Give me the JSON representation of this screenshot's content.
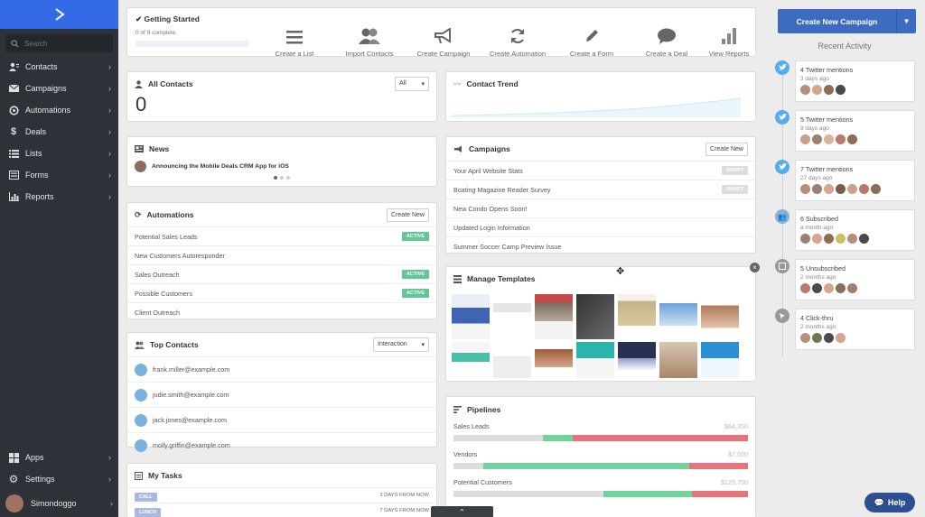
{
  "sidebar": {
    "search_placeholder": "Search",
    "items": [
      {
        "label": "Contacts",
        "icon": "contacts-icon"
      },
      {
        "label": "Campaigns",
        "icon": "mail-icon"
      },
      {
        "label": "Automations",
        "icon": "automation-icon"
      },
      {
        "label": "Deals",
        "icon": "dollar-icon"
      },
      {
        "label": "Lists",
        "icon": "list-icon"
      },
      {
        "label": "Forms",
        "icon": "form-icon"
      },
      {
        "label": "Reports",
        "icon": "chart-icon"
      }
    ],
    "bottom": [
      {
        "label": "Apps",
        "icon": "apps-icon"
      },
      {
        "label": "Settings",
        "icon": "gear-icon"
      }
    ],
    "user": "Simondoggo"
  },
  "getting_started": {
    "title": "Getting Started",
    "progress_text": "0 of 9 complete",
    "progress": 0
  },
  "tools": [
    {
      "label": "Create a List",
      "icon": "list-icon"
    },
    {
      "label": "Import Contacts",
      "icon": "users-icon"
    },
    {
      "label": "Create Campaign",
      "icon": "megaphone-icon"
    },
    {
      "label": "Create Automation",
      "icon": "refresh-icon"
    },
    {
      "label": "Create a Form",
      "icon": "pencil-icon"
    },
    {
      "label": "Create a Deal",
      "icon": "chat-icon"
    },
    {
      "label": "View Reports",
      "icon": "bar-chart-icon"
    }
  ],
  "all_contacts": {
    "title": "All Contacts",
    "count": "0",
    "filter": "All"
  },
  "contact_trend": {
    "title": "Contact Trend"
  },
  "news": {
    "title": "News",
    "headline": "Announcing the Mobile Deals CRM App for iOS"
  },
  "campaigns": {
    "title": "Campaigns",
    "create": "Create New",
    "rows": [
      {
        "name": "Your April Website Stats",
        "status": "DRAFT"
      },
      {
        "name": "Boating Magazine Reader Survey",
        "status": "DRAFT"
      },
      {
        "name": "New Condo Opens Soon!",
        "status": ""
      },
      {
        "name": "Updated Login Information",
        "status": ""
      },
      {
        "name": "Summer Soccer Camp Preview Issue",
        "status": ""
      }
    ]
  },
  "automations": {
    "title": "Automations",
    "create": "Create New",
    "rows": [
      {
        "name": "Potential Sales Leads",
        "status": "ACTIVE"
      },
      {
        "name": "New Customers Autoresponder",
        "status": ""
      },
      {
        "name": "Sales Outreach",
        "status": "ACTIVE"
      },
      {
        "name": "Possible Customers",
        "status": "ACTIVE"
      },
      {
        "name": "Client Outreach",
        "status": ""
      }
    ]
  },
  "templates": {
    "title": "Manage Templates"
  },
  "top_contacts": {
    "title": "Top Contacts",
    "sort": "Interaction",
    "rows": [
      "frank.miller@example.com",
      "judie.smith@example.com",
      "jack.jones@example.com",
      "molly.griffin@example.com"
    ]
  },
  "pipelines": {
    "title": "Pipelines",
    "rows": [
      {
        "name": "Sales Leads",
        "value": "$64,350"
      },
      {
        "name": "Vendors",
        "value": "$7,500"
      },
      {
        "name": "Potential Customers",
        "value": "$125,750"
      }
    ]
  },
  "tasks": {
    "title": "My Tasks",
    "rows": [
      {
        "type": "CALL",
        "due": "3 DAYS FROM NOW"
      },
      {
        "type": "LUNCH",
        "due": "7 DAYS FROM NOW"
      }
    ]
  },
  "right": {
    "create_campaign": "Create New Campaign",
    "recent_activity": "Recent Activity",
    "activity": [
      {
        "title": "4 Twitter mentions",
        "time": "3 days ago"
      },
      {
        "title": "5 Twitter mentions",
        "time": "9 days ago"
      },
      {
        "title": "7 Twitter mentions",
        "time": "27 days ago"
      },
      {
        "title": "6 Subscribed",
        "time": "a month ago"
      },
      {
        "title": "5 Unsubscribed",
        "time": "2 months ago"
      },
      {
        "title": "4 Click-thru",
        "time": "2 months ago"
      }
    ]
  },
  "help": "Help",
  "colors": {
    "brand": "#356ae6",
    "sidebar": "#2e3238",
    "active": "#62c796",
    "red": "#e8737a"
  }
}
